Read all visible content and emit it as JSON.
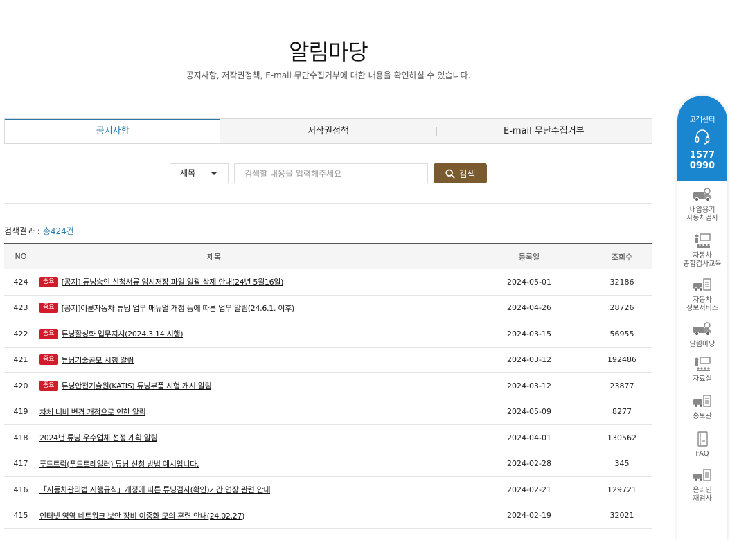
{
  "header": {
    "title": "알림마당",
    "description": "공지사항, 저작권정책, E-mail 무단수집거부에 대한 내용을 확인하실 수 있습니다."
  },
  "tabs": [
    {
      "label": "공지사항",
      "active": true
    },
    {
      "label": "저작권정책",
      "active": false
    },
    {
      "label": "E-mail 무단수집거부",
      "active": false
    }
  ],
  "search": {
    "select_value": "제목",
    "placeholder": "검색할 내용을 입력해주세요",
    "button_label": "검색"
  },
  "result": {
    "prefix": "검색결과 : ",
    "count": "총424건"
  },
  "table": {
    "headers": {
      "no": "NO",
      "title": "제목",
      "date": "등록일",
      "views": "조회수"
    },
    "badge_label": "중요",
    "rows": [
      {
        "no": "424",
        "important": true,
        "title": "[공지] 튜닝승인 신청서류 임시저장 파일 일괄 삭제 안내(24년 5월16일)",
        "date": "2024-05-01",
        "views": "32186"
      },
      {
        "no": "423",
        "important": true,
        "title": "[공지]이륜자동차 튜닝 업무 매뉴얼 개정 등에 따른 업무 알림(24.6.1. 이후)",
        "date": "2024-04-26",
        "views": "28726"
      },
      {
        "no": "422",
        "important": true,
        "title": "튜닝활성화 업무지시(2024.3.14 시행)",
        "date": "2024-03-15",
        "views": "56955"
      },
      {
        "no": "421",
        "important": true,
        "title": "튜닝기술공모 시행 알림",
        "date": "2024-03-12",
        "views": "192486"
      },
      {
        "no": "420",
        "important": true,
        "title": "튜닝안전기술원(KATIS) 튜닝부품 시험 개시 알림",
        "date": "2024-03-12",
        "views": "23877"
      },
      {
        "no": "419",
        "important": false,
        "title": "차체 너비 변경 개정으로 인한 알림",
        "date": "2024-05-09",
        "views": "8277"
      },
      {
        "no": "418",
        "important": false,
        "title": "2024년 튜닝 우수업체 선정 계획 알림",
        "date": "2024-04-01",
        "views": "130562"
      },
      {
        "no": "417",
        "important": false,
        "title": "푸드트럭(푸드트레일러) 튜닝 신청 방법 예시입니다.",
        "date": "2024-02-28",
        "views": "345"
      },
      {
        "no": "416",
        "important": false,
        "title": "「자동차관리법 시행규칙」개정에 따른 튜닝검사(확인)기간 연장 관련 안내",
        "date": "2024-02-21",
        "views": "129721"
      },
      {
        "no": "415",
        "important": false,
        "title": "인터넷 영역 네트워크 보안 장비 이중화 모의 훈련 안내(24.02.27)",
        "date": "2024-02-19",
        "views": "32021"
      }
    ]
  },
  "sidebar": {
    "center_label": "고객센터",
    "phone_line1": "1577",
    "phone_line2": "0990",
    "items": [
      {
        "icon": "truck-icon",
        "line1": "내압용기",
        "line2": "자동차검사"
      },
      {
        "icon": "classroom-icon",
        "line1": "자동차",
        "line2": "종합검사교육"
      },
      {
        "icon": "truck-document-icon",
        "line1": "자동차",
        "line2": "정보서비스"
      },
      {
        "icon": "truck-icon",
        "line1": "알림마당",
        "line2": ""
      },
      {
        "icon": "classroom-icon",
        "line1": "자료실",
        "line2": ""
      },
      {
        "icon": "truck-document-icon",
        "line1": "홍보관",
        "line2": ""
      },
      {
        "icon": "notebook-icon",
        "line1": "FAQ",
        "line2": ""
      },
      {
        "icon": "truck-document-icon",
        "line1": "온라인",
        "line2": "재검사"
      }
    ]
  },
  "colors": {
    "accent_blue": "#2a7aa8",
    "search_button": "#7a5a2f",
    "badge_red": "#d01b2b",
    "sidebar_blue": "#1a86d0"
  }
}
